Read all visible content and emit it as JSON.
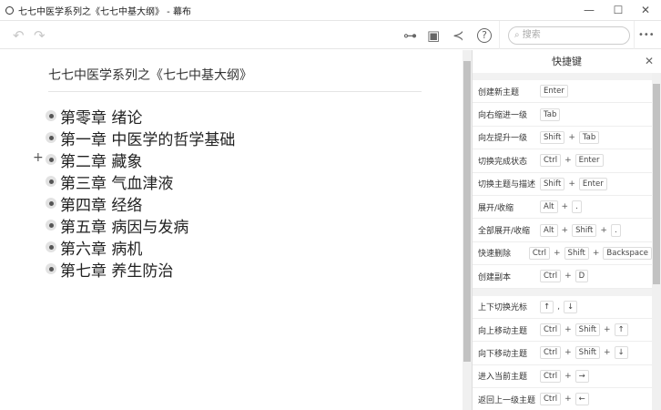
{
  "window": {
    "title": "七七中医学系列之《七七中基大纲》 - 幕布",
    "minimize": "—",
    "maximize": "☐",
    "close": "✕"
  },
  "toolbar": {
    "undo": "↶",
    "redo": "↷",
    "mindmap": "⊶",
    "present": "▣",
    "share": "≺",
    "help": "?",
    "search_placeholder": "搜索",
    "more": "•••"
  },
  "document": {
    "title": "七七中医学系列之《七七中基大纲》",
    "add": "+",
    "items": [
      "第零章  绪论",
      "第一章  中医学的哲学基础",
      "第二章  藏象",
      "第三章  气血津液",
      "第四章  经络",
      "第五章  病因与发病",
      "第六章  病机",
      "第七章  养生防治"
    ]
  },
  "shortcuts": {
    "title": "快捷键",
    "close": "✕",
    "groups": [
      [
        {
          "label": "创建新主题",
          "keys": [
            "Enter"
          ]
        },
        {
          "label": "向右缩进一级",
          "keys": [
            "Tab"
          ]
        },
        {
          "label": "向左提升一级",
          "keys": [
            "Shift",
            "Tab"
          ]
        },
        {
          "label": "切换完成状态",
          "keys": [
            "Ctrl",
            "Enter"
          ]
        },
        {
          "label": "切换主题与描述",
          "keys": [
            "Shift",
            "Enter"
          ]
        },
        {
          "label": "展开/收缩",
          "keys": [
            "Alt",
            "."
          ]
        },
        {
          "label": "全部展开/收缩",
          "keys": [
            "Alt",
            "Shift",
            "."
          ]
        },
        {
          "label": "快速删除",
          "keys": [
            "Ctrl",
            "Shift",
            "Backspace"
          ]
        },
        {
          "label": "创建副本",
          "keys": [
            "Ctrl",
            "D"
          ]
        }
      ],
      [
        {
          "label": "上下切换光标",
          "keys": [
            "↑",
            "↓"
          ],
          "sep": ","
        },
        {
          "label": "向上移动主题",
          "keys": [
            "Ctrl",
            "Shift",
            "↑"
          ]
        },
        {
          "label": "向下移动主题",
          "keys": [
            "Ctrl",
            "Shift",
            "↓"
          ]
        },
        {
          "label": "进入当前主题",
          "keys": [
            "Ctrl",
            "→"
          ]
        },
        {
          "label": "返回上一级主题",
          "keys": [
            "Ctrl",
            "←"
          ]
        }
      ]
    ]
  }
}
